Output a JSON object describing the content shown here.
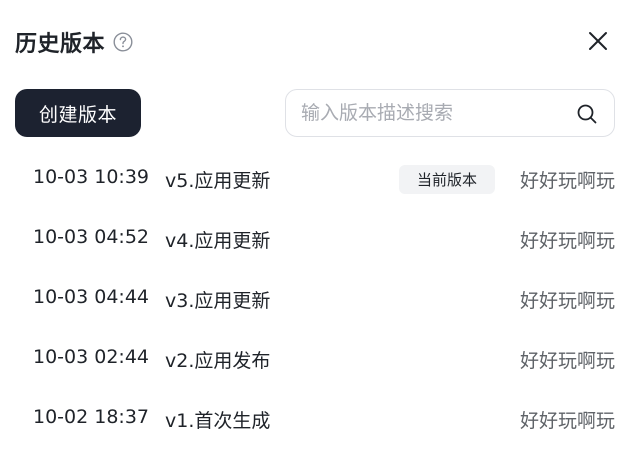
{
  "header": {
    "title": "历史版本"
  },
  "toolbar": {
    "create_label": "创建版本",
    "search_placeholder": "输入版本描述搜索",
    "search_value": ""
  },
  "versions": [
    {
      "time": "10-03 10:39",
      "desc": "v5.应用更新",
      "badge": "当前版本",
      "author": "好好玩啊玩"
    },
    {
      "time": "10-03 04:52",
      "desc": "v4.应用更新",
      "author": "好好玩啊玩"
    },
    {
      "time": "10-03 04:44",
      "desc": "v3.应用更新",
      "author": "好好玩啊玩"
    },
    {
      "time": "10-03 02:44",
      "desc": "v2.应用发布",
      "author": "好好玩啊玩"
    },
    {
      "time": "10-02 18:37",
      "desc": "v1.首次生成",
      "author": "好好玩啊玩"
    }
  ],
  "icons": {
    "help": "question-circle-icon",
    "close": "close-icon",
    "search": "search-icon"
  },
  "colors": {
    "primary_button": "#1c2230",
    "text": "#1f2329",
    "muted_text": "#5f6368",
    "placeholder": "#a8abb2",
    "badge_bg": "#f2f3f5",
    "border": "#dfe1e6"
  }
}
